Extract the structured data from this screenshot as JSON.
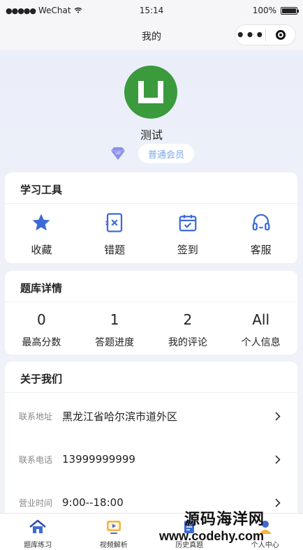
{
  "status_bar": {
    "signal": "●●●●●",
    "carrier": "WeChat",
    "time": "15:14",
    "battery": "100%"
  },
  "nav": {
    "title": "我的",
    "more": "•••"
  },
  "profile": {
    "avatar_letter": "U",
    "name": "测试",
    "vip_label": "VIP",
    "member_level": "普通会员"
  },
  "tools": {
    "title": "学习工具",
    "items": [
      {
        "label": "收藏",
        "icon": "star-icon"
      },
      {
        "label": "错题",
        "icon": "wrong-question-icon"
      },
      {
        "label": "签到",
        "icon": "calendar-check-icon"
      },
      {
        "label": "客服",
        "icon": "headset-icon"
      }
    ]
  },
  "bank": {
    "title": "题库详情",
    "stats": [
      {
        "value": "0",
        "label": "最高分数"
      },
      {
        "value": "1",
        "label": "答题进度"
      },
      {
        "value": "2",
        "label": "我的评论"
      },
      {
        "value": "All",
        "label": "个人信息"
      }
    ]
  },
  "about": {
    "title": "关于我们",
    "rows": [
      {
        "key": "联系地址",
        "value": "黑龙江省哈尔滨市道外区"
      },
      {
        "key": "联系电话",
        "value": "13999999999"
      },
      {
        "key": "营业时间",
        "value": "9:00--18:00"
      }
    ]
  },
  "tabbar": {
    "items": [
      {
        "label": "题库练习",
        "icon": "home-icon"
      },
      {
        "label": "视频解析",
        "icon": "video-icon"
      },
      {
        "label": "历史真题",
        "icon": "history-icon"
      },
      {
        "label": "个人中心",
        "icon": "user-icon"
      }
    ]
  },
  "watermark": {
    "line1": "源码海洋网",
    "line2": "www.codehy.com"
  },
  "colors": {
    "accent": "#3d6ad6",
    "avatar_bg": "#3b9a3c",
    "badge_text": "#7ca7e6"
  }
}
